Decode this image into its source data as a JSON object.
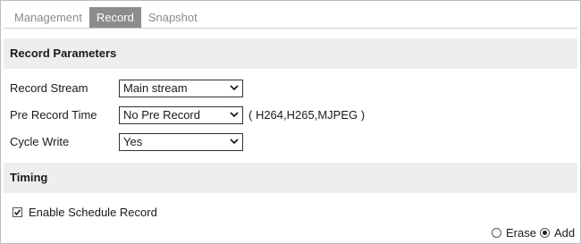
{
  "tabs": [
    {
      "label": "Management",
      "active": false
    },
    {
      "label": "Record",
      "active": true
    },
    {
      "label": "Snapshot",
      "active": false
    }
  ],
  "record_parameters": {
    "title": "Record Parameters",
    "record_stream": {
      "label": "Record Stream",
      "value": "Main stream"
    },
    "pre_record_time": {
      "label": "Pre Record Time",
      "value": "No Pre Record",
      "hint": "( H264,H265,MJPEG )"
    },
    "cycle_write": {
      "label": "Cycle Write",
      "value": "Yes"
    }
  },
  "timing": {
    "title": "Timing",
    "enable_schedule": {
      "label": "Enable Schedule Record",
      "checked": true
    },
    "mode": {
      "erase_label": "Erase",
      "add_label": "Add",
      "selected": "Add"
    }
  },
  "colors": {
    "active_tab_bg": "#8c8c8c",
    "section_header_bg": "#eeeeee"
  }
}
